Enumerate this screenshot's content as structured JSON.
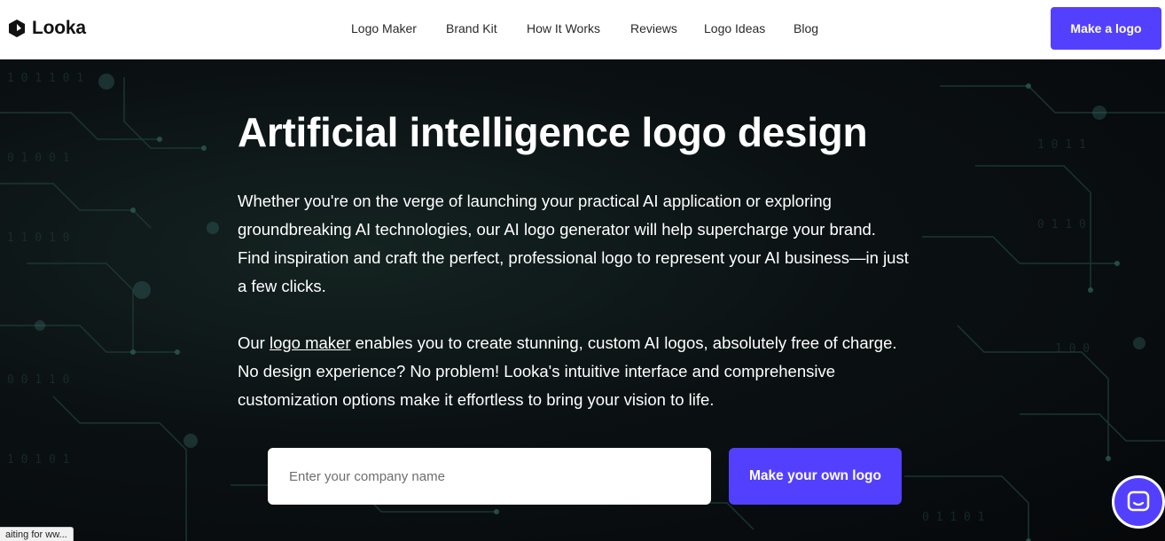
{
  "brand": {
    "name": "Looka",
    "logo_icon": "looka-logo-icon"
  },
  "nav": {
    "items": [
      {
        "label": "Logo Maker"
      },
      {
        "label": "Brand Kit"
      },
      {
        "label": "How It Works"
      },
      {
        "label": "Reviews"
      },
      {
        "label": "Logo Ideas"
      },
      {
        "label": "Blog"
      }
    ],
    "cta_label": "Make a logo"
  },
  "hero": {
    "title": "Artificial intelligence logo design",
    "paragraph1": "Whether you're on the verge of launching your practical AI application or exploring groundbreaking AI technologies, our AI logo generator will help supercharge your brand. Find inspiration and craft the perfect, professional logo to represent your AI business—in just a few clicks.",
    "paragraph2_before": "Our ",
    "paragraph2_link": "logo maker",
    "paragraph2_after": " enables you to create stunning, custom AI logos, absolutely free of charge. No design experience? No problem! Looka's intuitive interface and comprehensive customization options make it effortless to bring your vision to life.",
    "input_placeholder": "Enter your company name",
    "input_value": "",
    "cta_label": "Make your own logo"
  },
  "chat": {
    "icon": "chat-icon"
  },
  "status_bar": {
    "text": "aiting for ww..."
  },
  "colors": {
    "accent": "#5340ff",
    "header_bg": "#ffffff",
    "hero_bg": "#0a0d0f",
    "text_on_dark": "#ffffff"
  }
}
